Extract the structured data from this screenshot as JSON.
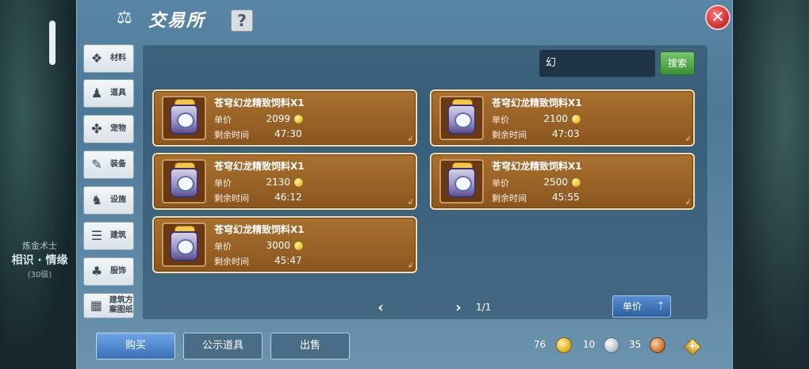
{
  "background": {
    "npc_subtitle": "炼金术士",
    "npc_name": "相识 · 情缘",
    "npc_level": "(30级)"
  },
  "header": {
    "title": "交易所",
    "help_label": "?",
    "close_label": "✕"
  },
  "categories": [
    {
      "label": "材料",
      "icon": "materials-icon"
    },
    {
      "label": "道具",
      "icon": "props-icon"
    },
    {
      "label": "宠物",
      "icon": "pet-paw-icon"
    },
    {
      "label": "装备",
      "icon": "equipment-icon"
    },
    {
      "label": "设施",
      "icon": "facility-icon"
    },
    {
      "label": "建筑",
      "icon": "building-icon"
    },
    {
      "label": "服饰",
      "icon": "clothing-icon"
    },
    {
      "label": "建筑方案图纸",
      "icon": "blueprint-icon"
    }
  ],
  "search": {
    "value": "幻",
    "button_label": "搜索"
  },
  "labels": {
    "unit_price": "单价",
    "remaining_time": "剩余时间"
  },
  "listings": [
    {
      "name": "苍穹幻龙精致饲料X1",
      "price": "2099",
      "time": "47:30"
    },
    {
      "name": "苍穹幻龙精致饲料X1",
      "price": "2100",
      "time": "47:03"
    },
    {
      "name": "苍穹幻龙精致饲料X1",
      "price": "2130",
      "time": "46:12"
    },
    {
      "name": "苍穹幻龙精致饲料X1",
      "price": "2500",
      "time": "45:55"
    },
    {
      "name": "苍穹幻龙精致饲料X1",
      "price": "3000",
      "time": "45:47"
    }
  ],
  "pagination": {
    "text": "1/1",
    "sort_label": "单价"
  },
  "bottom": {
    "buy_label": "购买",
    "public_label": "公示道具",
    "sell_label": "出售",
    "gold": "76",
    "silver": "10",
    "copper": "35"
  },
  "colors": {
    "card_brown": "#9a6228",
    "search_green": "#4fa845",
    "buy_blue": "#4f86cc"
  }
}
